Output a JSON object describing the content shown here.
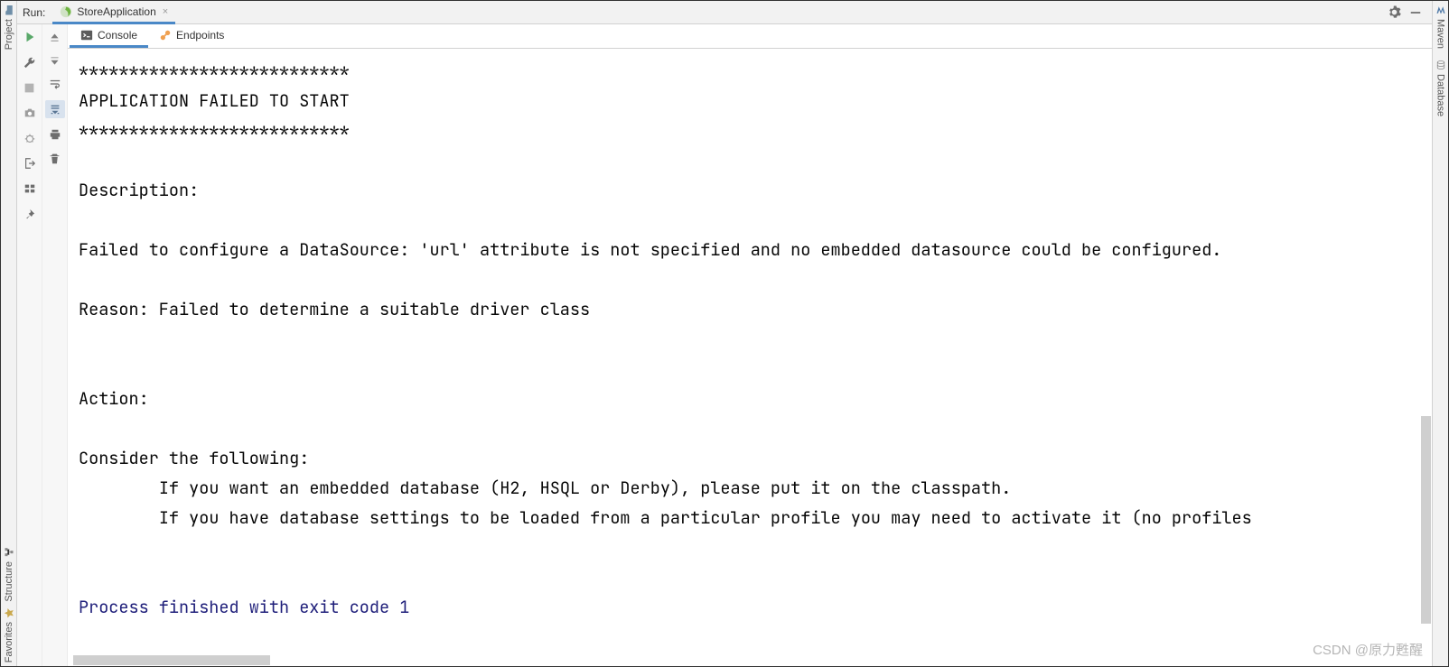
{
  "header": {
    "run_label": "Run:",
    "run_config": "StoreApplication"
  },
  "tabs": {
    "console": "Console",
    "endpoints": "Endpoints"
  },
  "left_bar": {
    "project": "Project",
    "structure": "Structure",
    "favorites": "Favorites"
  },
  "right_bar": {
    "maven": "Maven",
    "database": "Database"
  },
  "console": {
    "l01": "***************************",
    "l02": "APPLICATION FAILED TO START",
    "l03": "***************************",
    "l04": "",
    "l05": "Description:",
    "l06": "",
    "l07": "Failed to configure a DataSource: 'url' attribute is not specified and no embedded datasource could be configured.",
    "l08": "",
    "l09": "Reason: Failed to determine a suitable driver class",
    "l10": "",
    "l11": "",
    "l12": "Action:",
    "l13": "",
    "l14": "Consider the following:",
    "l15": "\tIf you want an embedded database (H2, HSQL or Derby), please put it on the classpath.",
    "l16": "\tIf you have database settings to be loaded from a particular profile you may need to activate it (no profiles",
    "l17": "",
    "l18": "",
    "exit": "Process finished with exit code 1"
  },
  "watermark": "CSDN @原力甦醒"
}
